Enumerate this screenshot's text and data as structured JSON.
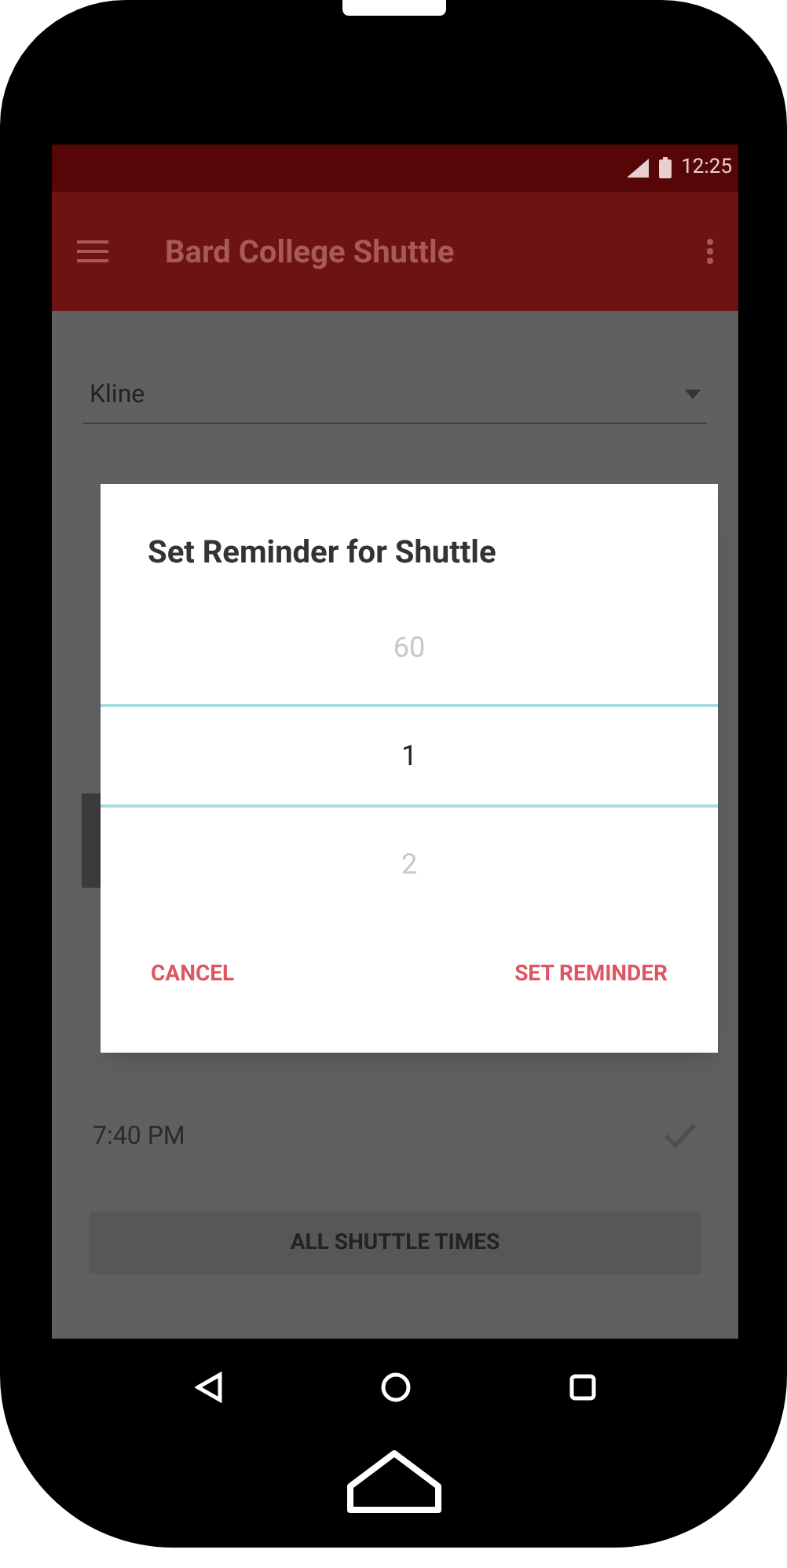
{
  "status_bar": {
    "time": "12:25"
  },
  "toolbar": {
    "title": "Bard College Shuttle"
  },
  "stop_select": {
    "value": "Kline"
  },
  "times": [
    {
      "time": "7:40 PM",
      "checked": true
    }
  ],
  "all_times_button": {
    "label": "ALL SHUTTLE TIMES"
  },
  "dialog": {
    "title": "Set Reminder for Shuttle",
    "picker": [
      {
        "value": "60",
        "selected": false
      },
      {
        "value": "1",
        "selected": true
      },
      {
        "value": "2",
        "selected": false
      }
    ],
    "buttons": [
      {
        "label": "CANCEL"
      },
      {
        "label": "SET REMINDER"
      }
    ]
  }
}
